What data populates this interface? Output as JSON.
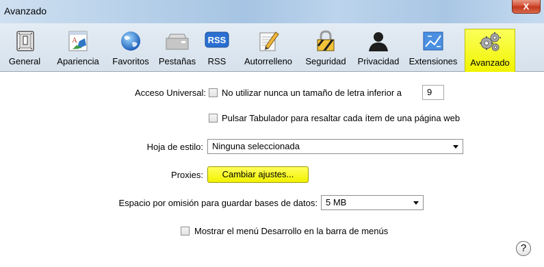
{
  "window": {
    "title": "Avanzado",
    "close_symbol": "X"
  },
  "toolbar": {
    "items": [
      {
        "label": "General",
        "icon": "general-switch-icon"
      },
      {
        "label": "Apariencia",
        "icon": "appearance-icon"
      },
      {
        "label": "Favoritos",
        "icon": "globe-icon"
      },
      {
        "label": "Pestañas",
        "icon": "tabs-icon"
      },
      {
        "label": "RSS",
        "icon": "rss-icon",
        "icon_text": "RSS"
      },
      {
        "label": "Autorrelleno",
        "icon": "pencil-icon"
      },
      {
        "label": "Seguridad",
        "icon": "padlock-icon"
      },
      {
        "label": "Privacidad",
        "icon": "person-silhouette-icon"
      },
      {
        "label": "Extensiones",
        "icon": "puzzle-icon"
      },
      {
        "label": "Avanzado",
        "icon": "gears-icon",
        "selected": true
      }
    ]
  },
  "accesibilidad": {
    "label": "Acceso Universal:",
    "min_font_label": "No utilizar nunca un tamaño de letra inferior a",
    "min_font_value": "9",
    "min_font_checked": false,
    "tab_label": "Pulsar Tabulador para resaltar cada ítem de una página web",
    "tab_checked": false
  },
  "stylesheet": {
    "label": "Hoja de estilo:",
    "value": "Ninguna seleccionada"
  },
  "proxies": {
    "label": "Proxies:",
    "button_label": "Cambiar ajustes..."
  },
  "database": {
    "label": "Espacio por omisión para guardar bases de datos:",
    "value": "5 MB"
  },
  "develop_menu": {
    "label": "Mostrar el menú Desarrollo en la barra de menús",
    "checked": false
  },
  "help": {
    "symbol": "?"
  },
  "colors": {
    "selected_highlight": "#f4f700",
    "titlebar": "#b9d2ea",
    "toolbar_bg": "#dce5ee"
  }
}
